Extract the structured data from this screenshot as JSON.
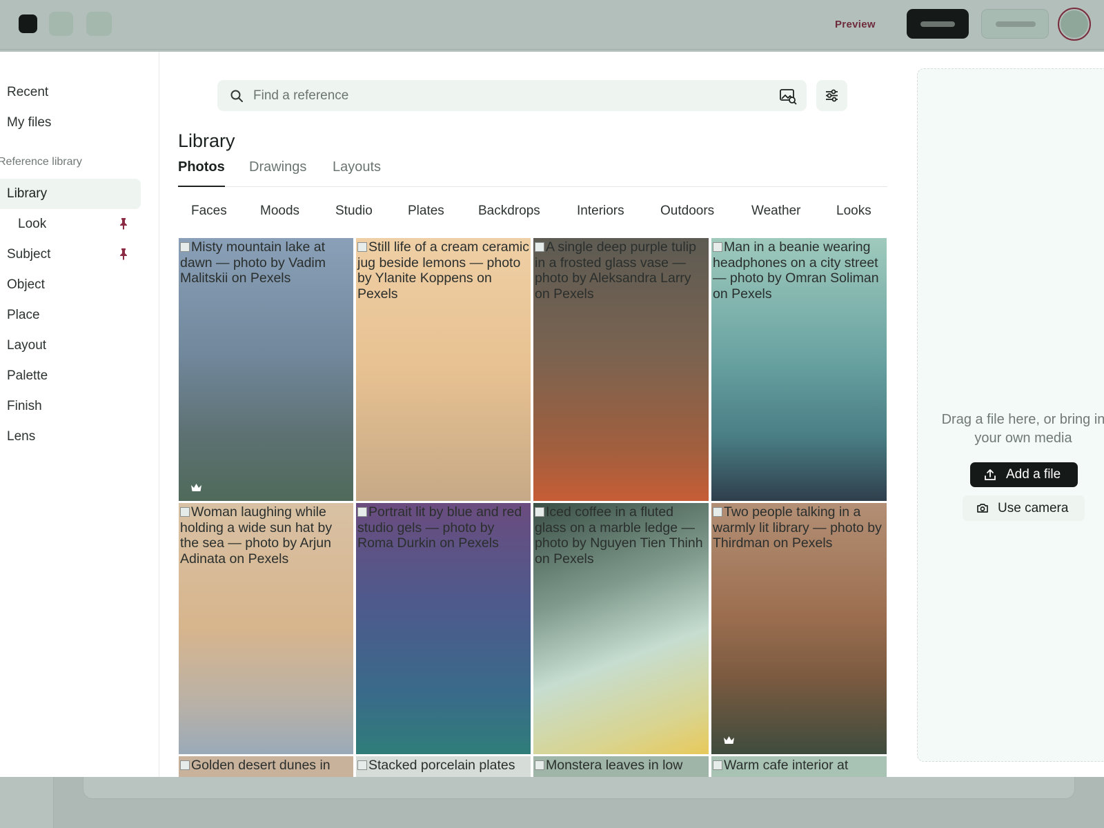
{
  "topbar": {
    "preview_label": "Preview"
  },
  "sidebar": {
    "top_items": [
      "Recent",
      "My files"
    ],
    "section_label": "Reference library",
    "items": [
      {
        "label": "Library",
        "active": true
      },
      {
        "label": "Look",
        "pinned": true
      },
      {
        "label": "Subject",
        "pinned": true
      },
      {
        "label": "Object"
      },
      {
        "label": "Place"
      },
      {
        "label": "Layout"
      },
      {
        "label": "Palette"
      },
      {
        "label": "Finish"
      },
      {
        "label": "Lens"
      }
    ]
  },
  "search": {
    "placeholder": "Find a reference"
  },
  "main": {
    "title": "Library",
    "tabs": [
      {
        "label": "Photos",
        "active": true
      },
      {
        "label": "Drawings"
      },
      {
        "label": "Layouts"
      }
    ],
    "categories": [
      "Faces",
      "Moods",
      "Studio",
      "Plates",
      "Backdrops",
      "Interiors",
      "Outdoors",
      "Weather",
      "Looks"
    ]
  },
  "grid": {
    "tiles": [
      {
        "caption": "Misty mountain lake at dawn — photo by Vadim Malitskii on Pexels",
        "premium": true
      },
      {
        "caption": "Still life of a cream ceramic jug beside lemons — photo by Ylanite Koppens on Pexels"
      },
      {
        "caption": "A single deep purple tulip in a frosted glass vase — photo by Aleksandra Larry on Pexels"
      },
      {
        "caption": "Man in a beanie wearing headphones on a city street — photo by Omran Soliman on Pexels"
      },
      {
        "caption": "Woman laughing while holding a wide sun hat by the sea — photo by Arjun Adinata on Pexels"
      },
      {
        "caption": "Portrait lit by blue and red studio gels — photo by Roma Durkin on Pexels"
      },
      {
        "caption": "Iced coffee in a fluted glass on a marble ledge — photo by Nguyen Tien Thinh on Pexels"
      },
      {
        "caption": "Two people talking in a warmly lit library — photo by Thirdman on Pexels",
        "premium": true
      },
      {
        "caption": "Golden desert dunes in"
      },
      {
        "caption": "Stacked porcelain plates"
      },
      {
        "caption": "Monstera leaves in low"
      },
      {
        "caption": "Warm cafe interior at"
      }
    ]
  },
  "upload": {
    "drop_text_line1": "Drag a file here, or bring in",
    "drop_text_line2": "your own media",
    "add_label": "Add a file",
    "camera_label": "Use camera"
  },
  "colors": {
    "accent": "#6e2b3c",
    "dark": "#151917",
    "surface": "#eef4f0"
  }
}
